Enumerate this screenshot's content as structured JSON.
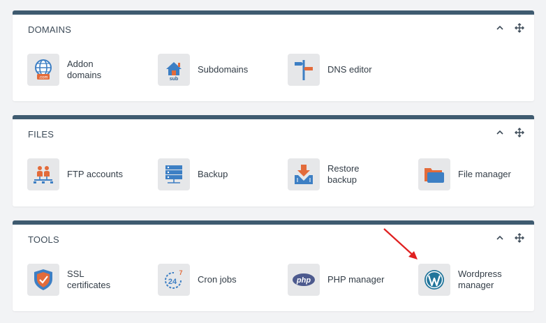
{
  "accent_color": "#3f5b70",
  "panels": [
    {
      "title": "DOMAINS",
      "items": [
        {
          "label": "Addon domains",
          "icon": "globe-com-icon"
        },
        {
          "label": "Subdomains",
          "icon": "house-sub-icon"
        },
        {
          "label": "DNS editor",
          "icon": "signpost-icon"
        }
      ]
    },
    {
      "title": "FILES",
      "items": [
        {
          "label": "FTP accounts",
          "icon": "users-network-icon"
        },
        {
          "label": "Backup",
          "icon": "server-stack-icon"
        },
        {
          "label": "Restore backup",
          "icon": "download-box-icon"
        },
        {
          "label": "File manager",
          "icon": "folder-icon"
        }
      ]
    },
    {
      "title": "TOOLS",
      "items": [
        {
          "label": "SSL certificates",
          "icon": "shield-icon"
        },
        {
          "label": "Cron jobs",
          "icon": "clock-24-7-icon"
        },
        {
          "label": "PHP manager",
          "icon": "php-logo-icon"
        },
        {
          "label": "Wordpress manager",
          "icon": "wordpress-logo-icon"
        }
      ]
    }
  ],
  "icon_text": {
    "com": ".com",
    "sub": "sub",
    "h24": "24",
    "d7": "7",
    "php": "php"
  }
}
